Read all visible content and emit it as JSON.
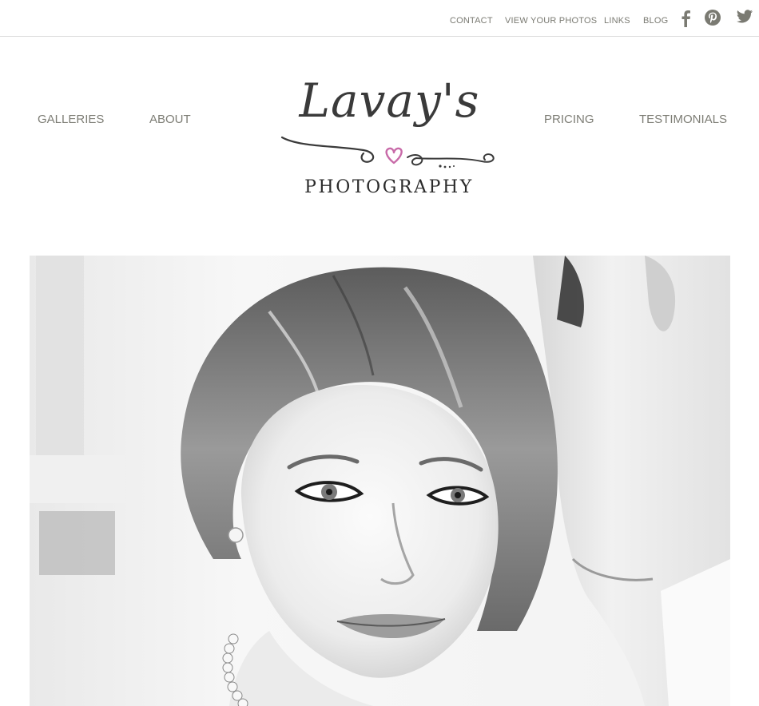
{
  "utility_nav": {
    "contact": "CONTACT",
    "view_photos": "VIEW YOUR PHOTOS",
    "links": "LINKS",
    "blog": "BLOG"
  },
  "social_icons": [
    "facebook-icon",
    "pinterest-icon",
    "twitter-icon"
  ],
  "main_nav": {
    "galleries": "GALLERIES",
    "about": "ABOUT",
    "pricing": "PRICING",
    "testimonials": "TESTIMONIALS"
  },
  "logo": {
    "script": "Lavay's",
    "subtitle": "PHOTOGRAPHY"
  },
  "colors": {
    "nav_text": "#7d7d75",
    "logo_text": "#3a3a3a",
    "heart_accent": "#c86aa8",
    "divider": "#dcdcdc"
  },
  "hero": {
    "style": "black-and-white portrait photograph"
  }
}
